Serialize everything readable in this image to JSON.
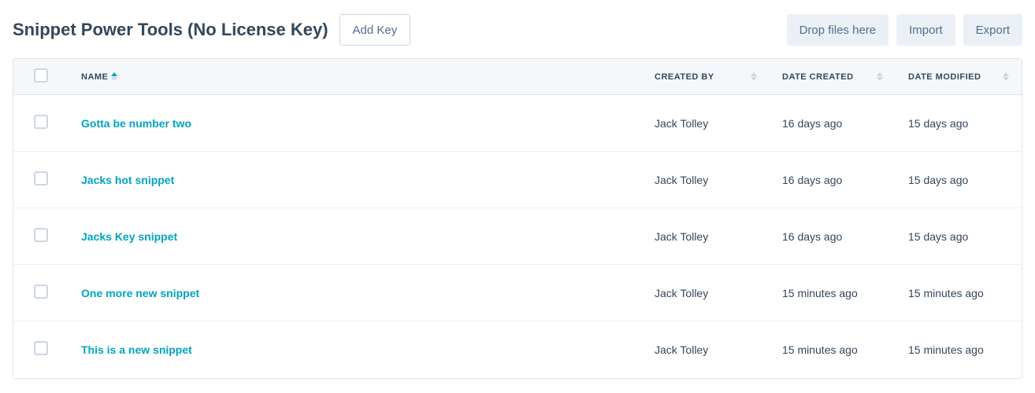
{
  "header": {
    "title": "Snippet Power Tools (No License Key)",
    "add_key_label": "Add Key"
  },
  "actions": {
    "drop_files": "Drop files here",
    "import": "Import",
    "export": "Export"
  },
  "table": {
    "columns": {
      "name": "Name",
      "created_by": "Created By",
      "date_created": "Date Created",
      "date_modified": "Date Modified"
    },
    "rows": [
      {
        "name": "Gotta be number two",
        "created_by": "Jack Tolley",
        "date_created": "16 days ago",
        "date_modified": "15 days ago"
      },
      {
        "name": "Jacks hot snippet",
        "created_by": "Jack Tolley",
        "date_created": "16 days ago",
        "date_modified": "15 days ago"
      },
      {
        "name": "Jacks Key snippet",
        "created_by": "Jack Tolley",
        "date_created": "16 days ago",
        "date_modified": "15 days ago"
      },
      {
        "name": "One more new snippet",
        "created_by": "Jack Tolley",
        "date_created": "15 minutes ago",
        "date_modified": "15 minutes ago"
      },
      {
        "name": "This is a new snippet",
        "created_by": "Jack Tolley",
        "date_created": "15 minutes ago",
        "date_modified": "15 minutes ago"
      }
    ]
  }
}
